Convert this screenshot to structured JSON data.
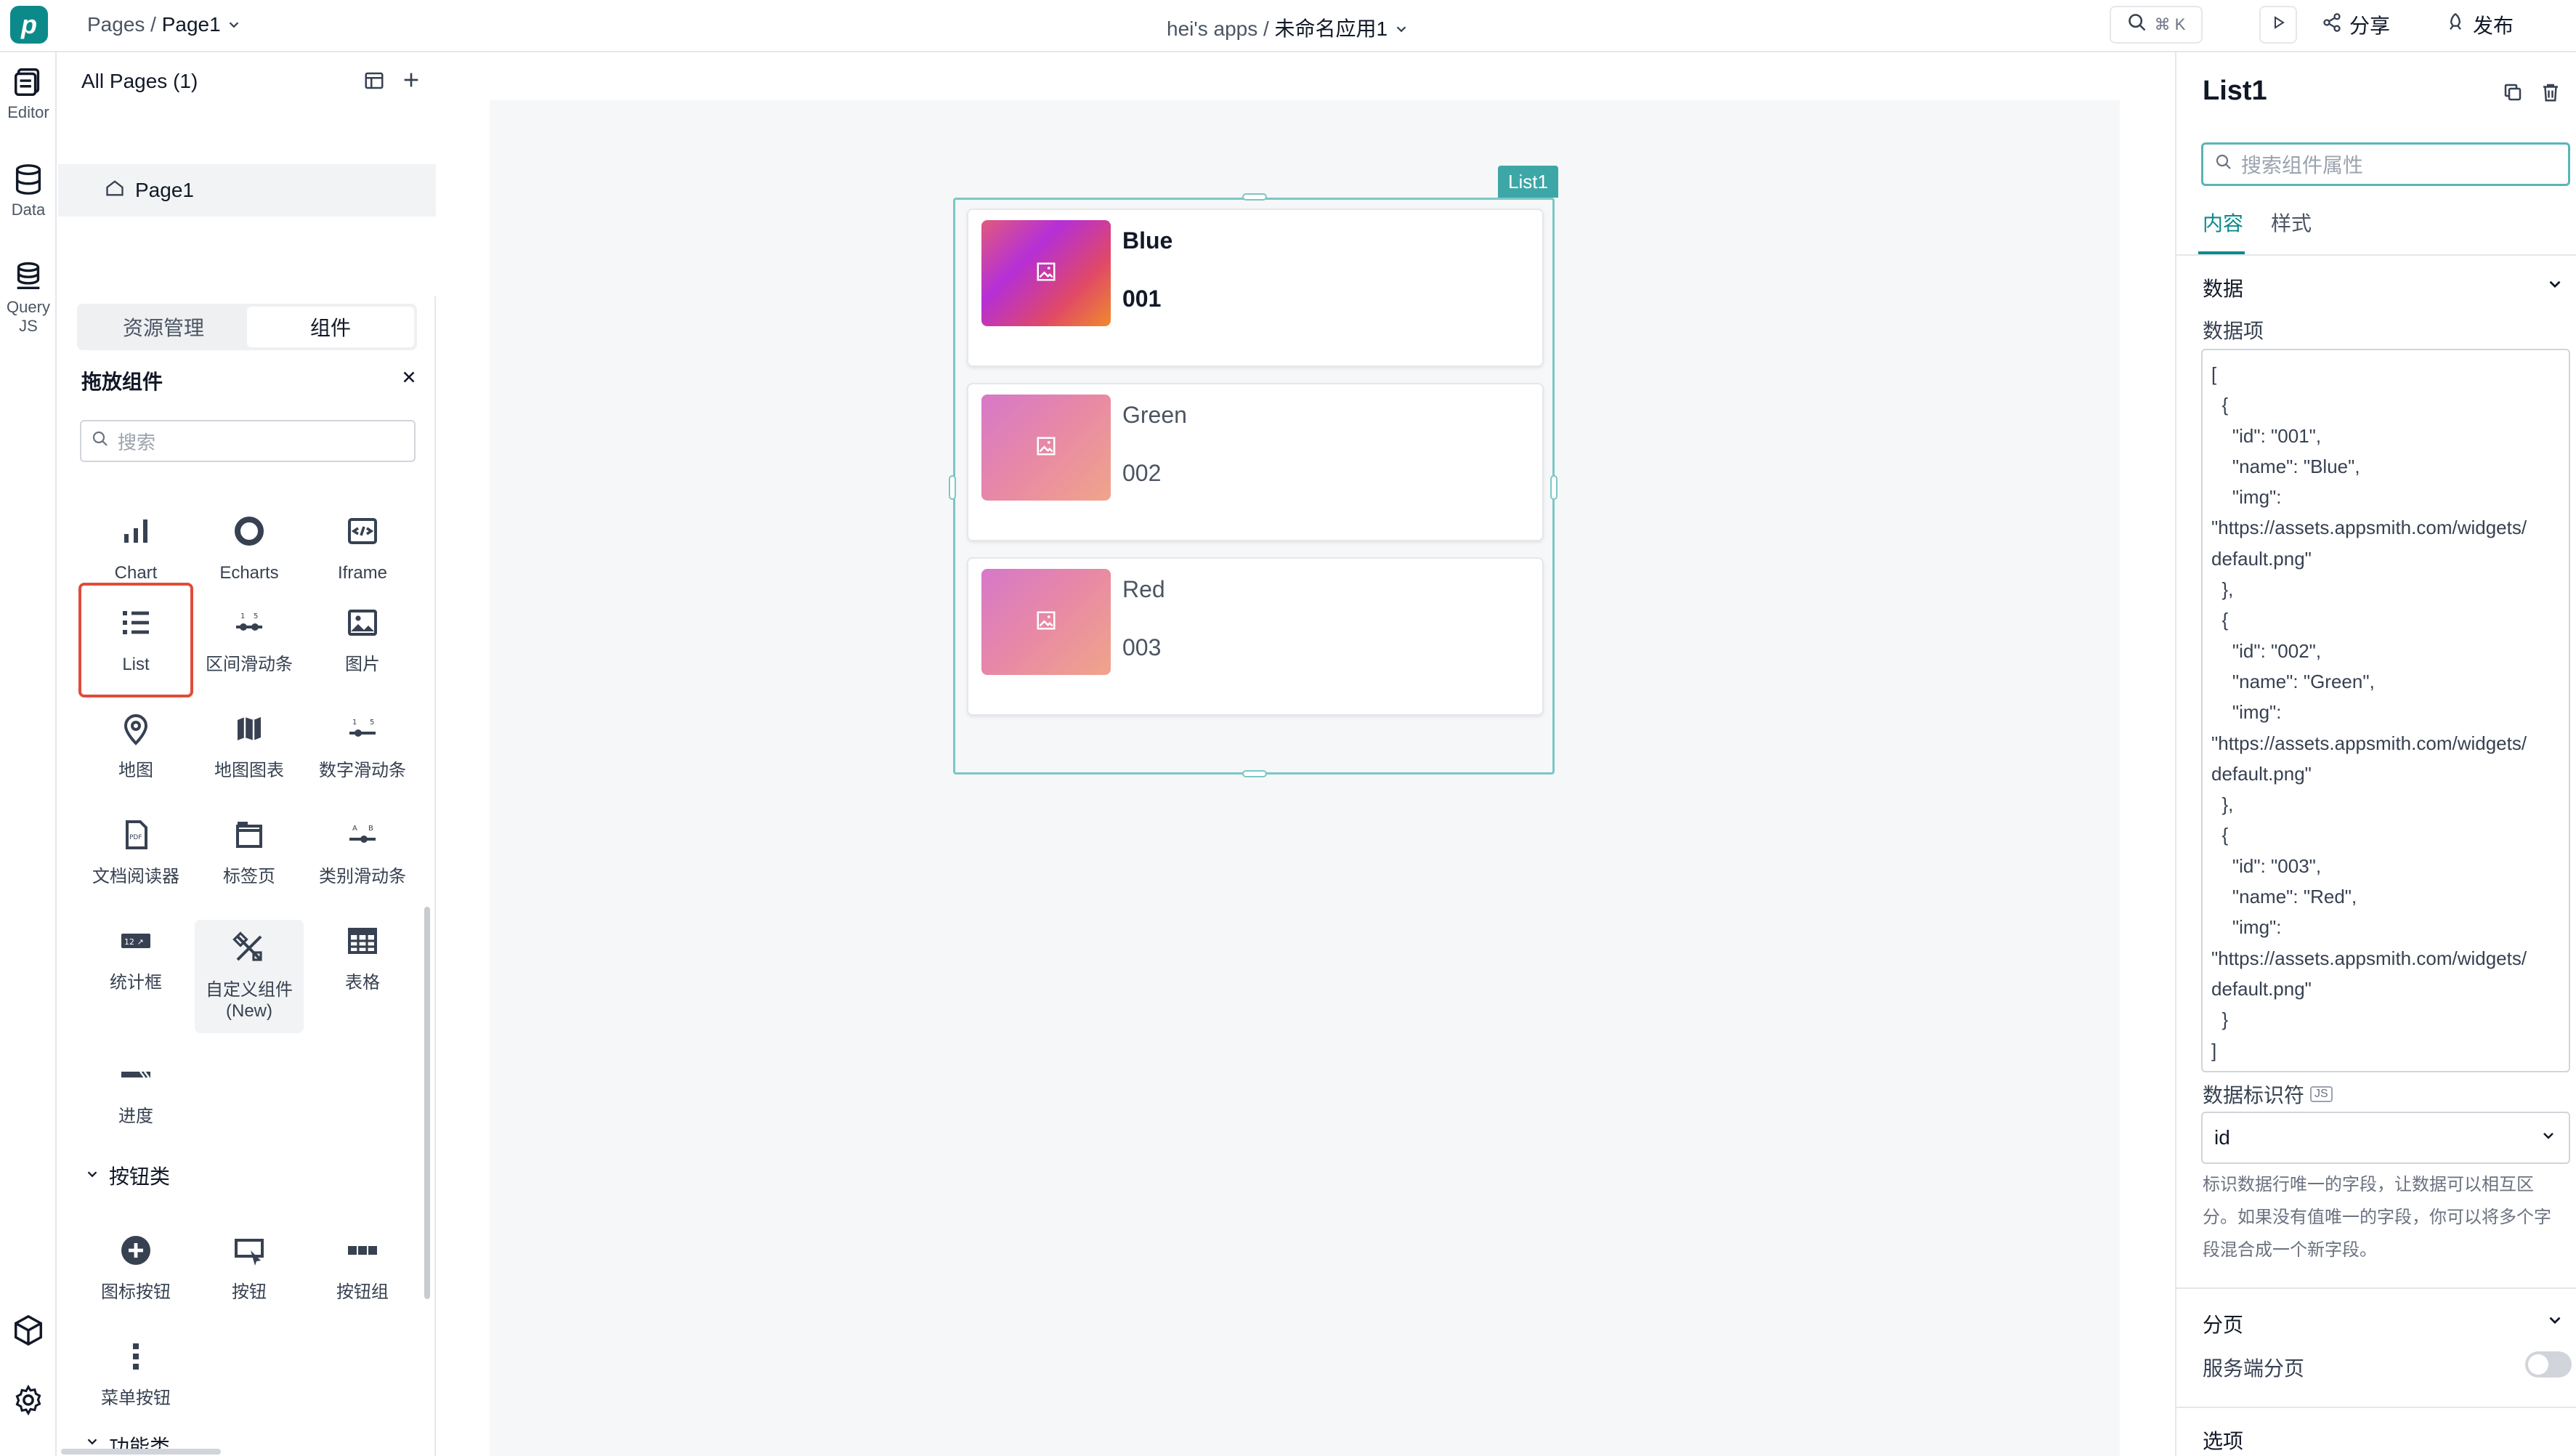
{
  "header": {
    "breadcrumb_prefix": "Pages /",
    "breadcrumb_page": "Page1",
    "app_path_prefix": "hei's apps /",
    "app_name": "未命名应用1",
    "search_shortcut": "⌘ K",
    "share_label": "分享",
    "publish_label": "发布"
  },
  "rail": {
    "items": [
      {
        "label": "Editor"
      },
      {
        "label": "Data"
      },
      {
        "label": "Query",
        "sub": "JS"
      }
    ]
  },
  "pages": {
    "title": "All Pages (1)",
    "items": [
      {
        "label": "Page1"
      }
    ]
  },
  "widget_panel": {
    "tabs": [
      "资源管理",
      "组件"
    ],
    "title": "拖放组件",
    "search_placeholder": "搜索",
    "widgets": [
      {
        "label": "Chart",
        "icon": "bar-chart-icon"
      },
      {
        "label": "Echarts",
        "icon": "echarts-icon"
      },
      {
        "label": "Iframe",
        "icon": "iframe-icon"
      },
      {
        "label": "List",
        "icon": "list-icon",
        "selected": true
      },
      {
        "label": "区间滑动条",
        "icon": "range-slider-icon"
      },
      {
        "label": "图片",
        "icon": "image-icon"
      },
      {
        "label": "地图",
        "icon": "map-pin-icon"
      },
      {
        "label": "地图图表",
        "icon": "map-chart-icon"
      },
      {
        "label": "数字滑动条",
        "icon": "number-slider-icon"
      },
      {
        "label": "文档阅读器",
        "icon": "pdf-icon"
      },
      {
        "label": "标签页",
        "icon": "tabs-icon"
      },
      {
        "label": "类别滑动条",
        "icon": "category-slider-icon"
      },
      {
        "label": "统计框",
        "icon": "stat-box-icon"
      },
      {
        "label": "自定义组件",
        "sub": "(New)",
        "icon": "custom-widget-icon"
      },
      {
        "label": "表格",
        "icon": "table-icon"
      },
      {
        "label": "进度",
        "icon": "progress-icon"
      }
    ],
    "group_buttons": "按钮类",
    "button_widgets": [
      {
        "label": "图标按钮",
        "icon": "plus-circle-icon"
      },
      {
        "label": "按钮",
        "icon": "button-icon"
      },
      {
        "label": "按钮组",
        "icon": "button-group-icon"
      },
      {
        "label": "菜单按钮",
        "icon": "kebab-menu-icon"
      }
    ],
    "group_next": "功能类"
  },
  "canvas": {
    "list_badge": "List1",
    "items": [
      {
        "name": "Blue",
        "id": "001",
        "bold": true
      },
      {
        "name": "Green",
        "id": "002",
        "bold": false
      },
      {
        "name": "Red",
        "id": "003",
        "bold": false
      }
    ]
  },
  "props": {
    "title": "List1",
    "search_placeholder": "搜索组件属性",
    "tabs": [
      "内容",
      "样式"
    ],
    "section_data": "数据",
    "data_label": "数据项",
    "data_json": "[\n  {\n    \"id\": \"001\",\n    \"name\": \"Blue\",\n    \"img\":\n\"https://assets.appsmith.com/widgets/\ndefault.png\"\n  },\n  {\n    \"id\": \"002\",\n    \"name\": \"Green\",\n    \"img\":\n\"https://assets.appsmith.com/widgets/\ndefault.png\"\n  },\n  {\n    \"id\": \"003\",\n    \"name\": \"Red\",\n    \"img\":\n\"https://assets.appsmith.com/widgets/\ndefault.png\"\n  }\n]",
    "key_label": "数据标识符",
    "key_badge": "JS",
    "key_value": "id",
    "key_help": "标识数据行唯一的字段，让数据可以相互区分。如果没有值唯一的字段，你可以将多个字段混合成一个新字段。",
    "section_pagination": "分页",
    "server_pagination_label": "服务端分页",
    "section_next": "选项"
  },
  "colors": {
    "accent": "#0c8a8a",
    "selected_outline": "#e14c3a",
    "list_border": "#7cc7c7"
  }
}
